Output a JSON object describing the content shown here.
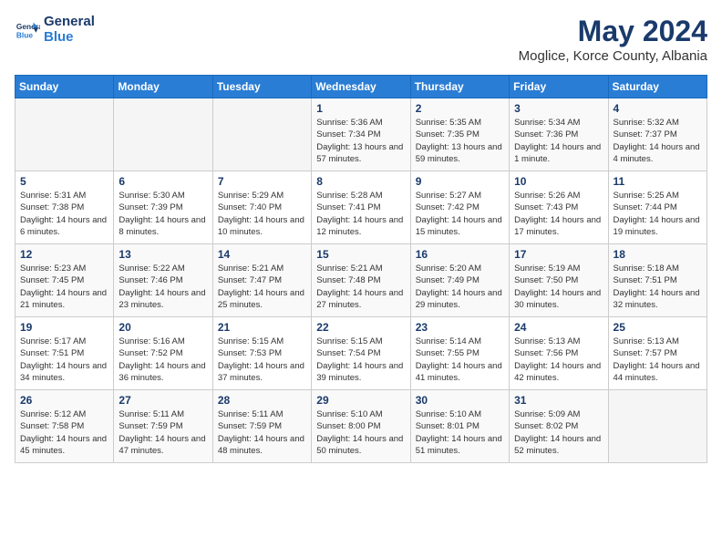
{
  "header": {
    "logo_line1": "General",
    "logo_line2": "Blue",
    "month": "May 2024",
    "location": "Moglice, Korce County, Albania"
  },
  "days_of_week": [
    "Sunday",
    "Monday",
    "Tuesday",
    "Wednesday",
    "Thursday",
    "Friday",
    "Saturday"
  ],
  "weeks": [
    [
      {
        "num": "",
        "info": ""
      },
      {
        "num": "",
        "info": ""
      },
      {
        "num": "",
        "info": ""
      },
      {
        "num": "1",
        "info": "Sunrise: 5:36 AM\nSunset: 7:34 PM\nDaylight: 13 hours\nand 57 minutes."
      },
      {
        "num": "2",
        "info": "Sunrise: 5:35 AM\nSunset: 7:35 PM\nDaylight: 13 hours\nand 59 minutes."
      },
      {
        "num": "3",
        "info": "Sunrise: 5:34 AM\nSunset: 7:36 PM\nDaylight: 14 hours\nand 1 minute."
      },
      {
        "num": "4",
        "info": "Sunrise: 5:32 AM\nSunset: 7:37 PM\nDaylight: 14 hours\nand 4 minutes."
      }
    ],
    [
      {
        "num": "5",
        "info": "Sunrise: 5:31 AM\nSunset: 7:38 PM\nDaylight: 14 hours\nand 6 minutes."
      },
      {
        "num": "6",
        "info": "Sunrise: 5:30 AM\nSunset: 7:39 PM\nDaylight: 14 hours\nand 8 minutes."
      },
      {
        "num": "7",
        "info": "Sunrise: 5:29 AM\nSunset: 7:40 PM\nDaylight: 14 hours\nand 10 minutes."
      },
      {
        "num": "8",
        "info": "Sunrise: 5:28 AM\nSunset: 7:41 PM\nDaylight: 14 hours\nand 12 minutes."
      },
      {
        "num": "9",
        "info": "Sunrise: 5:27 AM\nSunset: 7:42 PM\nDaylight: 14 hours\nand 15 minutes."
      },
      {
        "num": "10",
        "info": "Sunrise: 5:26 AM\nSunset: 7:43 PM\nDaylight: 14 hours\nand 17 minutes."
      },
      {
        "num": "11",
        "info": "Sunrise: 5:25 AM\nSunset: 7:44 PM\nDaylight: 14 hours\nand 19 minutes."
      }
    ],
    [
      {
        "num": "12",
        "info": "Sunrise: 5:23 AM\nSunset: 7:45 PM\nDaylight: 14 hours\nand 21 minutes."
      },
      {
        "num": "13",
        "info": "Sunrise: 5:22 AM\nSunset: 7:46 PM\nDaylight: 14 hours\nand 23 minutes."
      },
      {
        "num": "14",
        "info": "Sunrise: 5:21 AM\nSunset: 7:47 PM\nDaylight: 14 hours\nand 25 minutes."
      },
      {
        "num": "15",
        "info": "Sunrise: 5:21 AM\nSunset: 7:48 PM\nDaylight: 14 hours\nand 27 minutes."
      },
      {
        "num": "16",
        "info": "Sunrise: 5:20 AM\nSunset: 7:49 PM\nDaylight: 14 hours\nand 29 minutes."
      },
      {
        "num": "17",
        "info": "Sunrise: 5:19 AM\nSunset: 7:50 PM\nDaylight: 14 hours\nand 30 minutes."
      },
      {
        "num": "18",
        "info": "Sunrise: 5:18 AM\nSunset: 7:51 PM\nDaylight: 14 hours\nand 32 minutes."
      }
    ],
    [
      {
        "num": "19",
        "info": "Sunrise: 5:17 AM\nSunset: 7:51 PM\nDaylight: 14 hours\nand 34 minutes."
      },
      {
        "num": "20",
        "info": "Sunrise: 5:16 AM\nSunset: 7:52 PM\nDaylight: 14 hours\nand 36 minutes."
      },
      {
        "num": "21",
        "info": "Sunrise: 5:15 AM\nSunset: 7:53 PM\nDaylight: 14 hours\nand 37 minutes."
      },
      {
        "num": "22",
        "info": "Sunrise: 5:15 AM\nSunset: 7:54 PM\nDaylight: 14 hours\nand 39 minutes."
      },
      {
        "num": "23",
        "info": "Sunrise: 5:14 AM\nSunset: 7:55 PM\nDaylight: 14 hours\nand 41 minutes."
      },
      {
        "num": "24",
        "info": "Sunrise: 5:13 AM\nSunset: 7:56 PM\nDaylight: 14 hours\nand 42 minutes."
      },
      {
        "num": "25",
        "info": "Sunrise: 5:13 AM\nSunset: 7:57 PM\nDaylight: 14 hours\nand 44 minutes."
      }
    ],
    [
      {
        "num": "26",
        "info": "Sunrise: 5:12 AM\nSunset: 7:58 PM\nDaylight: 14 hours\nand 45 minutes."
      },
      {
        "num": "27",
        "info": "Sunrise: 5:11 AM\nSunset: 7:59 PM\nDaylight: 14 hours\nand 47 minutes."
      },
      {
        "num": "28",
        "info": "Sunrise: 5:11 AM\nSunset: 7:59 PM\nDaylight: 14 hours\nand 48 minutes."
      },
      {
        "num": "29",
        "info": "Sunrise: 5:10 AM\nSunset: 8:00 PM\nDaylight: 14 hours\nand 50 minutes."
      },
      {
        "num": "30",
        "info": "Sunrise: 5:10 AM\nSunset: 8:01 PM\nDaylight: 14 hours\nand 51 minutes."
      },
      {
        "num": "31",
        "info": "Sunrise: 5:09 AM\nSunset: 8:02 PM\nDaylight: 14 hours\nand 52 minutes."
      },
      {
        "num": "",
        "info": ""
      }
    ]
  ]
}
